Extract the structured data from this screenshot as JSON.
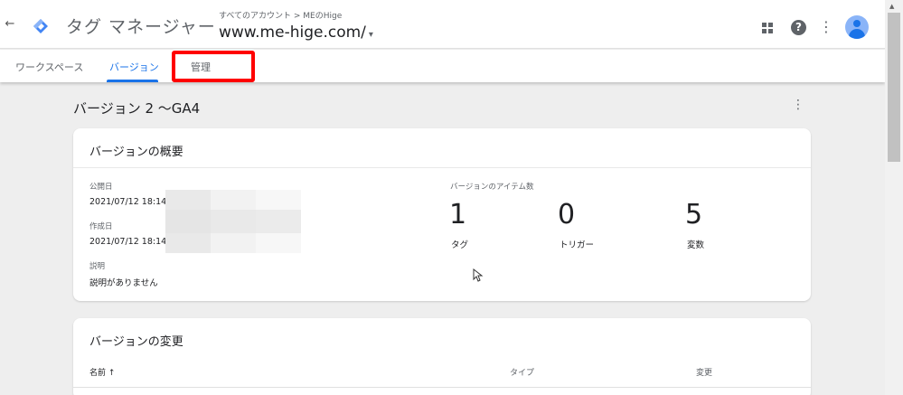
{
  "header": {
    "back_icon": "arrow-left-icon",
    "app_title": "タグ マネージャー",
    "breadcrumb": "すべてのアカウント > MEのHige",
    "container_name": "www.me-hige.com/",
    "container_caret": "▾",
    "brand_color": "#1a73e8"
  },
  "tabs": [
    {
      "label": "ワークスペース"
    },
    {
      "label": "バージョン"
    },
    {
      "label": "管理"
    }
  ],
  "version": {
    "title": "バージョン 2 ～GA4",
    "more_icon": "⋮"
  },
  "summary": {
    "title": "バージョンの概要",
    "published_label": "公開日",
    "published_value": "2021/07/12 18:14",
    "created_label": "作成日",
    "created_value": "2021/07/12 18:14",
    "description_label": "説明",
    "description_value": "説明がありません",
    "items_label": "バージョンのアイテム数",
    "counts": [
      {
        "value": "1",
        "label": "タグ"
      },
      {
        "value": "0",
        "label": "トリガー"
      },
      {
        "value": "5",
        "label": "変数"
      }
    ]
  },
  "changes": {
    "title": "バージョンの変更",
    "columns": [
      "名前 ↑",
      "タイプ",
      "変更"
    ]
  },
  "top_icons": {
    "apps": "apps-grid-icon",
    "help": "?",
    "more": "⋮",
    "avatar": "user-avatar-icon"
  },
  "scrollbar": {
    "up_arrow": "▲"
  }
}
